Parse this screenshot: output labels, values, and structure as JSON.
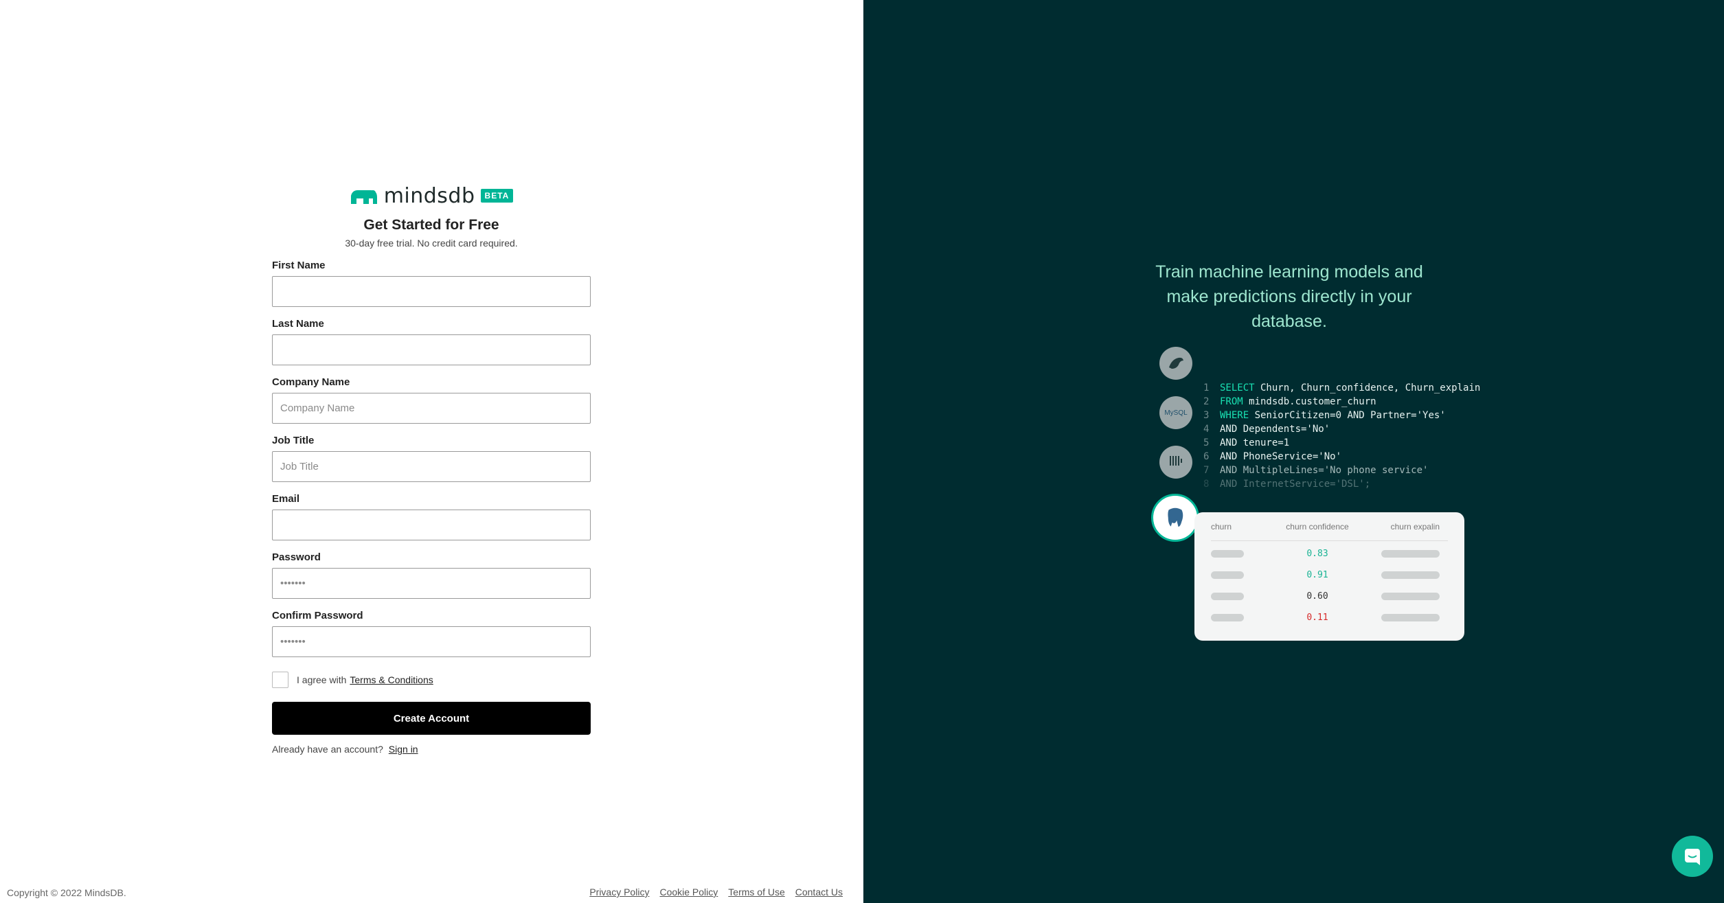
{
  "brand": {
    "name": "mindsdb",
    "badge": "BETA"
  },
  "signup": {
    "title": "Get Started for Free",
    "subtitle": "30-day free trial. No credit card required.",
    "fields": [
      {
        "label": "First Name",
        "value": "",
        "placeholder": ""
      },
      {
        "label": "Last Name",
        "value": "",
        "placeholder": ""
      },
      {
        "label": "Company Name",
        "value": "",
        "placeholder": "Company Name"
      },
      {
        "label": "Job Title",
        "value": "",
        "placeholder": "Job Title"
      },
      {
        "label": "Email",
        "value": "",
        "placeholder": ""
      },
      {
        "label": "Password",
        "value": "",
        "placeholder": "•••••••"
      },
      {
        "label": "Confirm Password",
        "value": "",
        "placeholder": "•••••••"
      }
    ],
    "agree_text": "I agree with",
    "terms_link": "Terms & Conditions",
    "create_button": "Create Account",
    "signin_prompt": "Already have an account?",
    "signin_link": "Sign in"
  },
  "footer": {
    "copyright": "Copyright © 2022 MindsDB.",
    "links": [
      "Privacy Policy",
      "Cookie Policy",
      "Terms of Use",
      "Contact Us"
    ]
  },
  "promo": {
    "tagline": "Train machine learning models and make predictions directly in your database.",
    "db_icons": [
      "mariadb-icon",
      "mysql-icon",
      "clickhouse-icon",
      "postgresql-icon"
    ],
    "db_labels": [
      "MariaDB",
      "MySQL",
      "ClickHouse"
    ],
    "code_lines": [
      {
        "n": "1",
        "kw": "SELECT",
        "rest": " Churn, Churn_confidence, Churn_explain"
      },
      {
        "n": "2",
        "kw": "FROM",
        "rest": " mindsdb.customer_churn"
      },
      {
        "n": "3",
        "kw": "WHERE",
        "rest": " SeniorCitizen=0 AND Partner='Yes'"
      },
      {
        "n": "4",
        "kw": "",
        "rest": "AND Dependents='No'"
      },
      {
        "n": "5",
        "kw": "",
        "rest": "AND tenure=1"
      },
      {
        "n": "6",
        "kw": "",
        "rest": "AND PhoneService='No'"
      },
      {
        "n": "7",
        "kw": "",
        "rest": "AND MultipleLines='No phone service'"
      },
      {
        "n": "8",
        "kw": "",
        "rest": "AND InternetService='DSL';"
      }
    ],
    "result_headers": [
      "churn",
      "churn confidence",
      "churn expalin"
    ],
    "result_values": [
      "0.83",
      "0.91",
      "0.60",
      "0.11"
    ],
    "result_colors": [
      "#19b394",
      "#19b394",
      "#333333",
      "#d62a2a"
    ]
  }
}
